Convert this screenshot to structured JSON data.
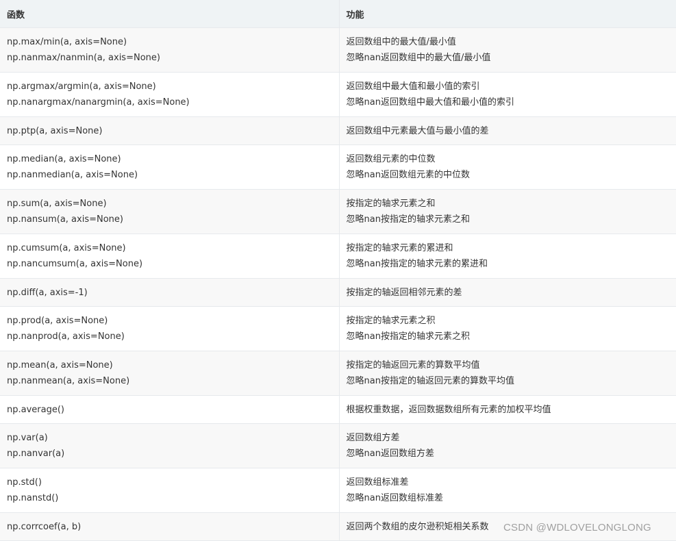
{
  "table": {
    "headers": [
      "函数",
      "功能"
    ],
    "rows": [
      {
        "func": [
          "np.max/min(a, axis=None)",
          "np.nanmax/nanmin(a, axis=None)"
        ],
        "desc": [
          "返回数组中的最大值/最小值",
          "忽略nan返回数组中的最大值/最小值"
        ]
      },
      {
        "func": [
          "np.argmax/argmin(a, axis=None)",
          "np.nanargmax/nanargmin(a, axis=None)"
        ],
        "desc": [
          "返回数组中最大值和最小值的索引",
          "忽略nan返回数组中最大值和最小值的索引"
        ]
      },
      {
        "func": [
          "np.ptp(a, axis=None)"
        ],
        "desc": [
          "返回数组中元素最大值与最小值的差"
        ]
      },
      {
        "func": [
          "np.median(a, axis=None)",
          "np.nanmedian(a, axis=None)"
        ],
        "desc": [
          "返回数组元素的中位数",
          "忽略nan返回数组元素的中位数"
        ]
      },
      {
        "func": [
          "np.sum(a, axis=None)",
          "np.nansum(a, axis=None)"
        ],
        "desc": [
          "按指定的轴求元素之和",
          "忽略nan按指定的轴求元素之和"
        ]
      },
      {
        "func": [
          "np.cumsum(a, axis=None)",
          "np.nancumsum(a, axis=None)"
        ],
        "desc": [
          "按指定的轴求元素的累进和",
          "忽略nan按指定的轴求元素的累进和"
        ]
      },
      {
        "func": [
          "np.diff(a, axis=-1)"
        ],
        "desc": [
          "按指定的轴返回相邻元素的差"
        ]
      },
      {
        "func": [
          "np.prod(a, axis=None)",
          "np.nanprod(a, axis=None)"
        ],
        "desc": [
          "按指定的轴求元素之积",
          "忽略nan按指定的轴求元素之积"
        ]
      },
      {
        "func": [
          "np.mean(a, axis=None)",
          "np.nanmean(a, axis=None)"
        ],
        "desc": [
          "按指定的轴返回元素的算数平均值",
          "忽略nan按指定的轴返回元素的算数平均值"
        ]
      },
      {
        "func": [
          "np.average()"
        ],
        "desc": [
          "根据权重数据，返回数据数组所有元素的加权平均值"
        ]
      },
      {
        "func": [
          "np.var(a)",
          "np.nanvar(a)"
        ],
        "desc": [
          "返回数组方差",
          "忽略nan返回数组方差"
        ]
      },
      {
        "func": [
          "np.std()",
          "np.nanstd()"
        ],
        "desc": [
          "返回数组标准差",
          "忽略nan返回数组标准差"
        ]
      },
      {
        "func": [
          "np.corrcoef(a, b)"
        ],
        "desc": [
          "返回两个数组的皮尔逊积矩相关系数"
        ]
      }
    ]
  },
  "watermark": "CSDN @WDLOVELONGLONG"
}
